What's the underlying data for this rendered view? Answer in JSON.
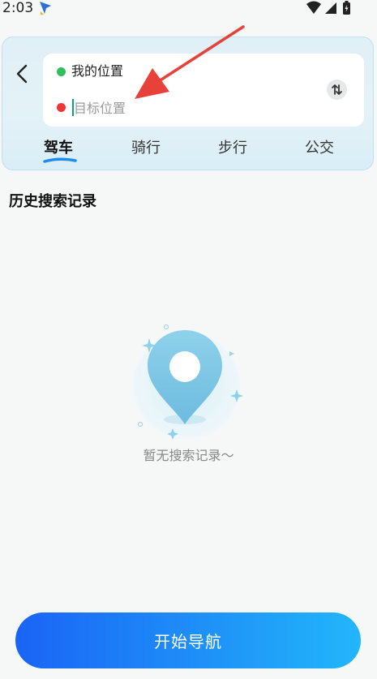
{
  "status_bar": {
    "time": "2:03"
  },
  "route": {
    "origin_label": "我的位置",
    "destination_value": "",
    "destination_placeholder": "目标位置"
  },
  "tabs": [
    {
      "label": "驾车",
      "active": true
    },
    {
      "label": "骑行",
      "active": false
    },
    {
      "label": "步行",
      "active": false
    },
    {
      "label": "公交",
      "active": false
    }
  ],
  "history": {
    "title": "历史搜索记录",
    "empty_text": "暂无搜索记录～"
  },
  "start_button": {
    "label": "开始导航"
  },
  "colors": {
    "origin_dot": "#2fbf5e",
    "destination_dot": "#ee3434",
    "button_gradient_start": "#1a64f5",
    "button_gradient_end": "#22b6fa",
    "annotation_arrow": "#e8413a"
  },
  "icons": [
    "back-icon",
    "swap-icon",
    "location-pin-icon",
    "wifi-icon",
    "signal-icon",
    "battery-icon"
  ]
}
